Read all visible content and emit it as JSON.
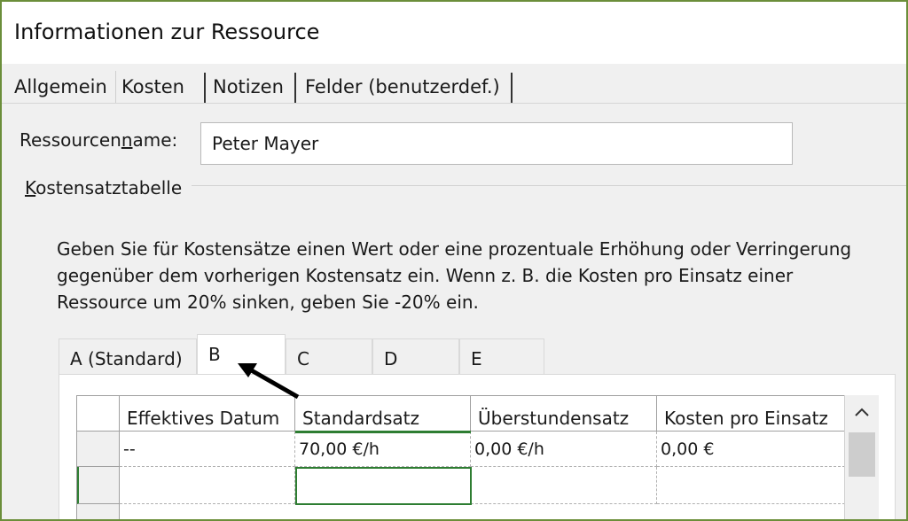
{
  "window": {
    "title": "Informationen zur Ressource"
  },
  "tabs": [
    {
      "label": "Allgemein",
      "selected": false
    },
    {
      "label": "Kosten",
      "selected": true
    },
    {
      "label": "Notizen",
      "selected": false
    },
    {
      "label": "Felder (benutzerdef.)",
      "selected": false
    }
  ],
  "resource_name": {
    "label_before": "Ressourcen",
    "label_mnemonic": "n",
    "label_after": "ame:",
    "value": "Peter Mayer"
  },
  "cost_table": {
    "group_mnemonic": "K",
    "group_rest": "ostensatztabelle",
    "description": "Geben Sie für Kostensätze einen Wert oder eine prozentuale Erhöhung oder Verringerung gegenüber dem vorherigen Kostensatz ein. Wenn z. B. die Kosten pro Einsatz einer Ressource um 20% sinken, geben Sie -20% ein.",
    "rate_tabs": [
      {
        "label": "A (Standard)",
        "selected": false
      },
      {
        "label": "B",
        "selected": true
      },
      {
        "label": "C",
        "selected": false
      },
      {
        "label": "D",
        "selected": false
      },
      {
        "label": "E",
        "selected": false
      }
    ],
    "columns": [
      "Effektives Datum",
      "Standardsatz",
      "Überstundensatz",
      "Kosten pro Einsatz"
    ],
    "rows": [
      [
        "--",
        "70,00 €/h",
        "0,00 €/h",
        "0,00 €"
      ],
      [
        "",
        "",
        "",
        ""
      ]
    ],
    "scroll_up_icon": "chevron-up-icon"
  },
  "colors": {
    "frame_border": "#6b8e3a",
    "selection": "#2e7d32",
    "arrow": "#000000"
  }
}
